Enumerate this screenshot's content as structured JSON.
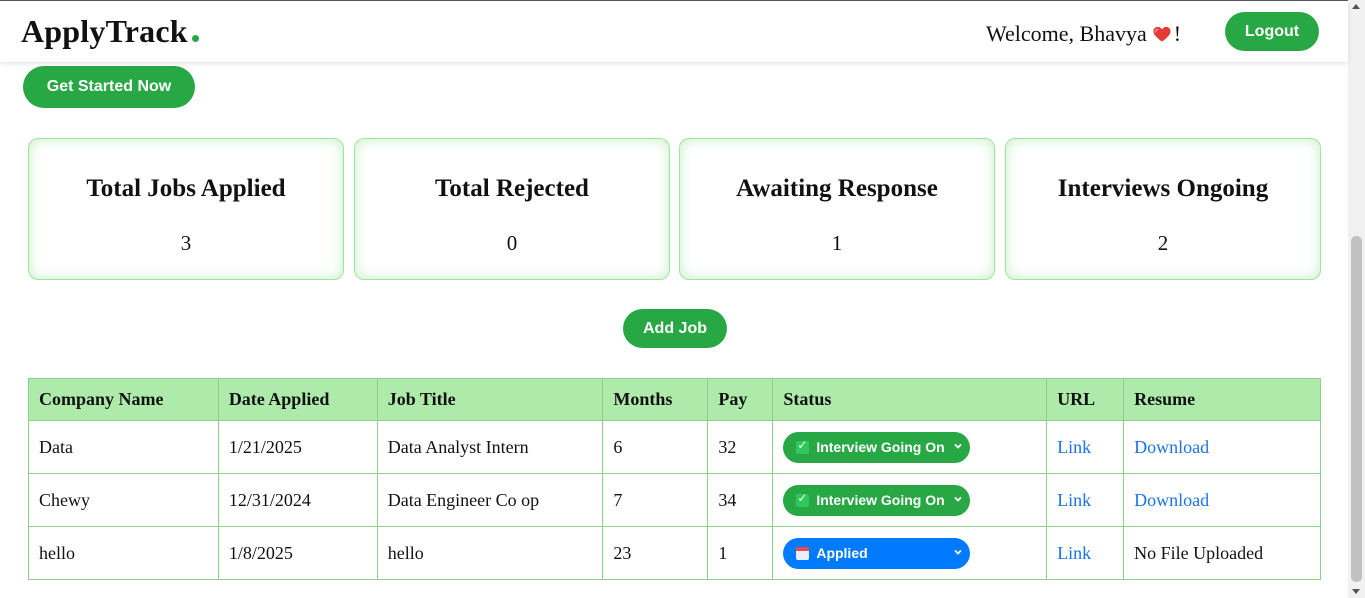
{
  "header": {
    "brand": "ApplyTrack",
    "welcome_prefix": "Welcome, Bhavya",
    "welcome_suffix": "!",
    "logout_label": "Logout"
  },
  "hero": {
    "get_started_label": "Get Started Now"
  },
  "stats": [
    {
      "title": "Total Jobs Applied",
      "value": "3"
    },
    {
      "title": "Total Rejected",
      "value": "0"
    },
    {
      "title": "Awaiting Response",
      "value": "1"
    },
    {
      "title": "Interviews Ongoing",
      "value": "2"
    }
  ],
  "actions": {
    "add_job_label": "Add Job"
  },
  "table": {
    "headers": [
      "Company Name",
      "Date Applied",
      "Job Title",
      "Months",
      "Pay",
      "Status",
      "URL",
      "Resume"
    ],
    "rows": [
      {
        "company": "Data",
        "date": "1/21/2025",
        "title": "Data Analyst Intern",
        "months": "6",
        "pay": "32",
        "status": "Interview Going On",
        "status_icon": "check-icon",
        "status_color": "#28a745",
        "url": "Link",
        "resume": "Download"
      },
      {
        "company": "Chewy",
        "date": "12/31/2024",
        "title": "Data Engineer Co op",
        "months": "7",
        "pay": "34",
        "status": "Interview Going On",
        "status_icon": "check-icon",
        "status_color": "#28a745",
        "url": "Link",
        "resume": "Download"
      },
      {
        "company": "hello",
        "date": "1/8/2025",
        "title": "hello",
        "months": "23",
        "pay": "1",
        "status": "Applied",
        "status_icon": "calendar-icon",
        "status_color": "#007bff",
        "url": "Link",
        "resume": "No File Uploaded"
      }
    ]
  },
  "colors": {
    "accent": "#28a745",
    "link": "#1a73e8",
    "applied": "#007bff",
    "table_header": "#aeeaa9"
  }
}
